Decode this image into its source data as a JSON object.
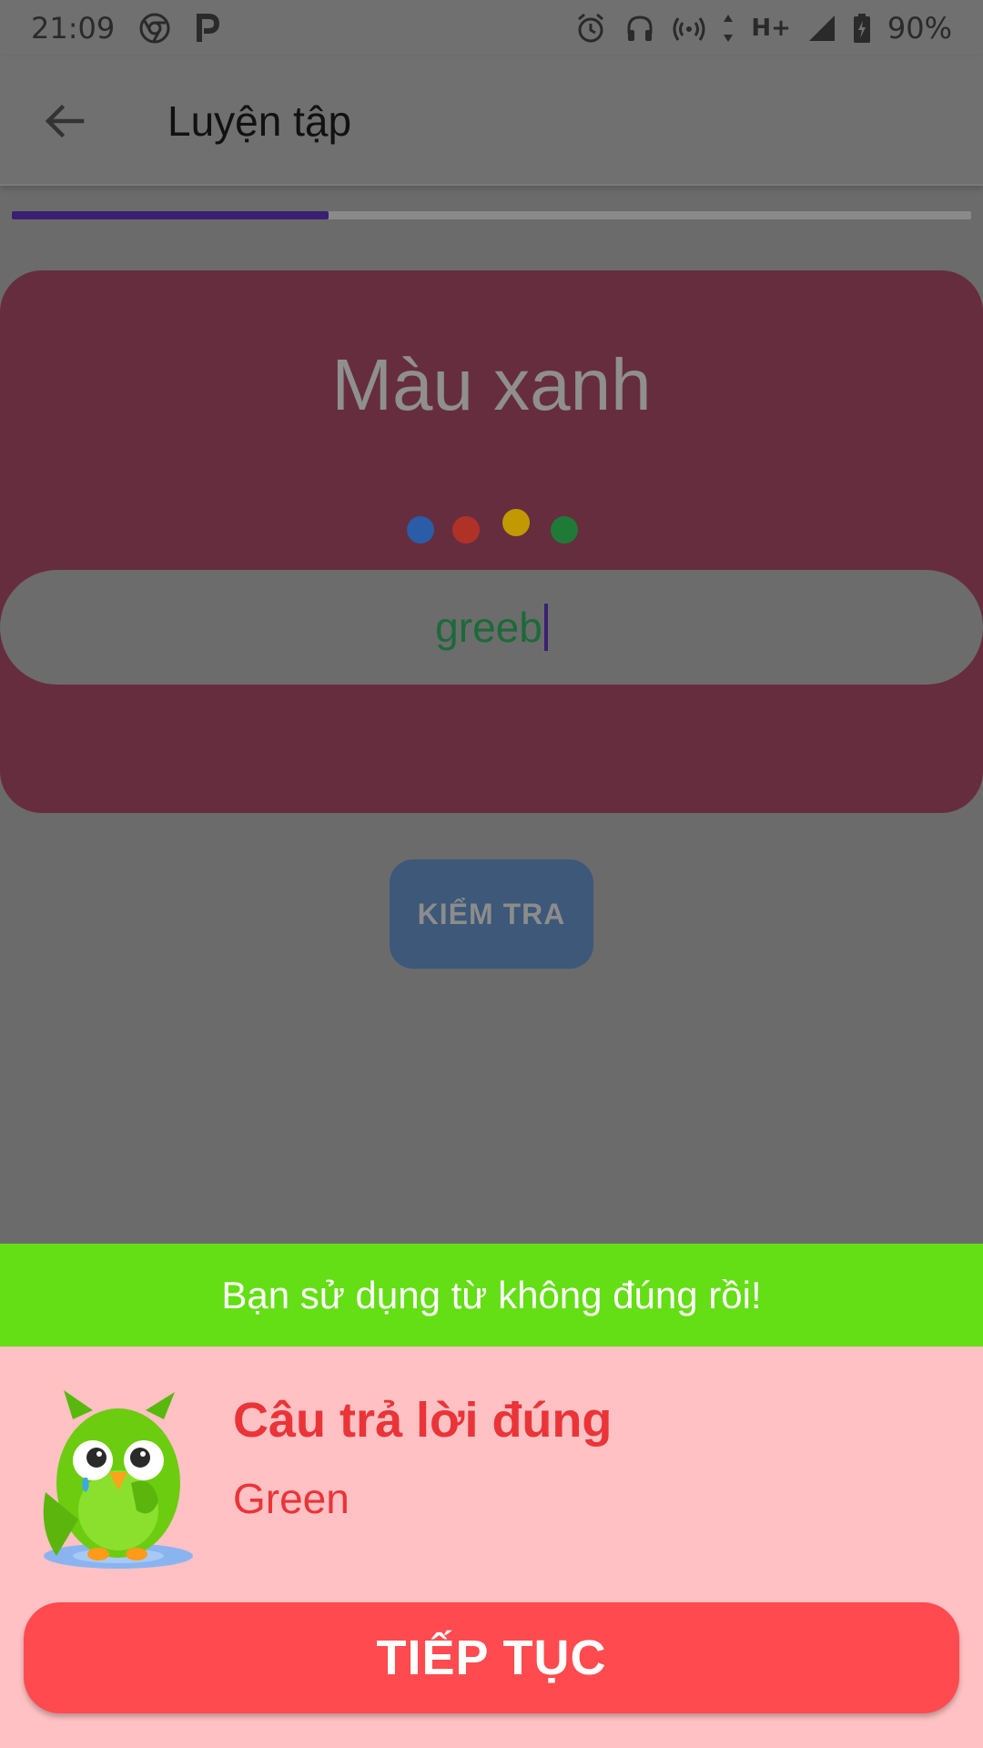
{
  "status_bar": {
    "time": "21:09",
    "network_label": "H+",
    "battery": "90%",
    "icons": [
      "chrome-icon",
      "parking-app-icon",
      "alarm-icon",
      "headset-icon",
      "hotspot-icon",
      "network-arrows-icon",
      "signal-icon",
      "battery-icon"
    ]
  },
  "app_bar": {
    "title": "Luyện tập",
    "back_icon": "arrow-left-icon"
  },
  "progress": {
    "value": 0.33,
    "color": "#3a2070"
  },
  "card": {
    "word": "Màu xanh",
    "dots": [
      "#2a5ca8",
      "#b03227",
      "#c29a00",
      "#1f7a38"
    ],
    "answer_value": "greeb",
    "background": "#662d3e"
  },
  "check_button": {
    "label": "KIỂM TRA"
  },
  "result": {
    "banner_text": "Bạn sử dụng từ không đúng rồi!",
    "title": "Câu trả lời đúng",
    "correct_answer": "Green",
    "mascot_icon": "crying-owl-icon",
    "continue_label": "TIẾP TỤC",
    "colors": {
      "banner": "#64de15",
      "sheet": "#ffc1c3",
      "accent": "#ea3438",
      "button": "#ff4b4f"
    }
  }
}
